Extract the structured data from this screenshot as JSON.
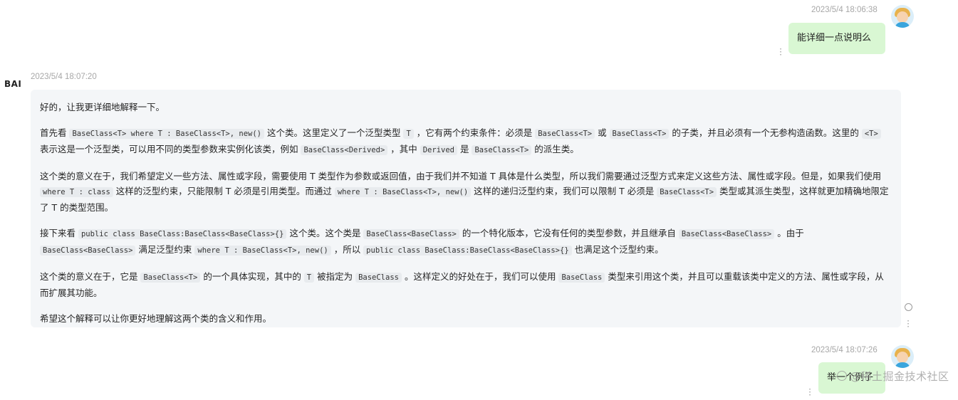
{
  "messages": {
    "user1": {
      "time": "2023/5/4 18:06:38",
      "text": "能详细一点说明么"
    },
    "bot": {
      "logo": "BAI",
      "time": "2023/5/4 18:07:20",
      "p1": "好的，让我更详细地解释一下。",
      "p2": {
        "t1": "首先看 ",
        "c1": "BaseClass<T> where T : BaseClass<T>, new()",
        "t2": " 这个类。这里定义了一个泛型类型 ",
        "c2": "T",
        "t3": " ，它有两个约束条件：必须是 ",
        "c3": "BaseClass<T>",
        "t4": " 或 ",
        "c4": "BaseClass<T>",
        "t5": " 的子类，并且必须有一个无参构造函数。这里的 ",
        "c5": "<T>",
        "t6": " 表示这是一个泛型类，可以用不同的类型参数来实例化该类，例如 ",
        "c6": "BaseClass<Derived>",
        "t7": " ，其中 ",
        "c7": "Derived",
        "t8": " 是 ",
        "c8": "BaseClass<T>",
        "t9": " 的派生类。"
      },
      "p3": {
        "t1": "这个类的意义在于，我们希望定义一些方法、属性或字段，需要使用 T 类型作为参数或返回值，由于我们并不知道 T 具体是什么类型，所以我们需要通过泛型方式来定义这些方法、属性或字段。但是，如果我们使用 ",
        "c1": "where T : class",
        "t2": " 这样的泛型约束，只能限制 T 必须是引用类型。而通过 ",
        "c2": "where T : BaseClass<T>, new()",
        "t3": " 这样的递归泛型约束，我们可以限制 T 必须是 ",
        "c3": "BaseClass<T>",
        "t4": " 类型或其派生类型，这样就更加精确地限定了 T 的类型范围。"
      },
      "p4": {
        "t1": "接下来看 ",
        "c1": "public class BaseClass:BaseClass<BaseClass>{}",
        "t2": " 这个类。这个类是 ",
        "c2": "BaseClass<BaseClass>",
        "t3": " 的一个特化版本，它没有任何的类型参数，并且继承自 ",
        "c3": "BaseClass<BaseClass>",
        "t4": " 。由于 ",
        "c4": "BaseClass<BaseClass>",
        "t5": " 满足泛型约束 ",
        "c5": "where T : BaseClass<T>, new()",
        "t6": " ，所以 ",
        "c6": "public class BaseClass:BaseClass<BaseClass>{}",
        "t7": " 也满足这个泛型约束。"
      },
      "p5": {
        "t1": "这个类的意义在于，它是 ",
        "c1": "BaseClass<T>",
        "t2": " 的一个具体实现，其中的 ",
        "c2": "T",
        "t3": " 被指定为 ",
        "c3": "BaseClass",
        "t4": " 。这样定义的好处在于，我们可以使用 ",
        "c4": "BaseClass",
        "t5": " 类型来引用这个类，并且可以重载该类中定义的方法、属性或字段，从而扩展其功能。"
      },
      "p6": "希望这个解释可以让你更好地理解这两个类的含义和作用。"
    },
    "user2": {
      "time": "2023/5/4 18:07:26",
      "text": "举一个例子"
    }
  },
  "watermark": "@稀土掘金技术社区",
  "colors": {
    "user_bubble": "#d9f7d3",
    "bot_bubble": "#f4f6f8",
    "timestamp": "#a7a7a7"
  }
}
